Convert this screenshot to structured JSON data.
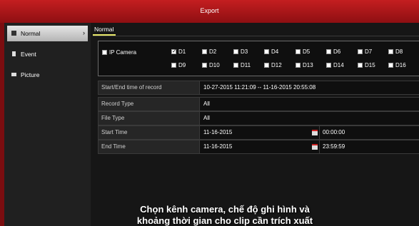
{
  "window": {
    "title": "Export"
  },
  "sidebar": {
    "items": [
      {
        "label": "Normal",
        "active": true
      },
      {
        "label": "Event",
        "active": false
      },
      {
        "label": "Picture",
        "active": false
      }
    ]
  },
  "tab": {
    "label": "Normal"
  },
  "camera": {
    "ip_camera_label": "IP Camera",
    "channels_row1": [
      "D1",
      "D2",
      "D3",
      "D4",
      "D5",
      "D6",
      "D7",
      "D8"
    ],
    "channels_row2": [
      "D9",
      "D10",
      "D11",
      "D12",
      "D13",
      "D14",
      "D15",
      "D16"
    ],
    "checked": [
      "D1"
    ]
  },
  "form": {
    "start_end_label": "Start/End time of record",
    "start_end_value": "10-27-2015 11:21:09 -- 11-16-2015 20:55:08",
    "record_type_label": "Record Type",
    "record_type_value": "All",
    "file_type_label": "File Type",
    "file_type_value": "All",
    "start_time_label": "Start Time",
    "start_date": "11-16-2015",
    "start_clock": "00:00:00",
    "end_time_label": "End Time",
    "end_date": "11-16-2015",
    "end_clock": "23:59:59"
  },
  "caption": {
    "line1": "Chọn kênh camera, chế độ ghi hình và",
    "line2": "khoảng thời gian cho clip cần trích xuất"
  }
}
